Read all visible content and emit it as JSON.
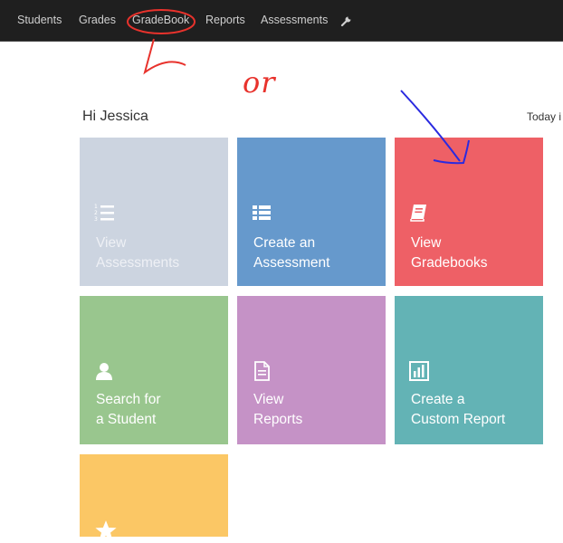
{
  "nav": {
    "items": [
      "Students",
      "Grades",
      "GradeBook",
      "Reports",
      "Assessments"
    ],
    "settings_icon": "wrench-icon"
  },
  "annotations": {
    "or_text": "or"
  },
  "greeting": "Hi Jessica",
  "today_text": "Today i",
  "tiles": [
    {
      "label": "View\nAssessments",
      "icon": "numbered-list-icon",
      "color": "#ccd4e0"
    },
    {
      "label": "Create an\nAssessment",
      "icon": "list-icon",
      "color": "#6699cc"
    },
    {
      "label": "View\nGradebooks",
      "icon": "book-icon",
      "color": "#ee6066"
    },
    {
      "label": "Search for\na Student",
      "icon": "user-icon",
      "color": "#99c68e"
    },
    {
      "label": "View\nReports",
      "icon": "document-icon",
      "color": "#c592c6"
    },
    {
      "label": "Create a\nCustom Report",
      "icon": "bar-chart-icon",
      "color": "#63b3b5"
    },
    {
      "label": "",
      "icon": "star-icon",
      "color": "#fbc765"
    }
  ]
}
